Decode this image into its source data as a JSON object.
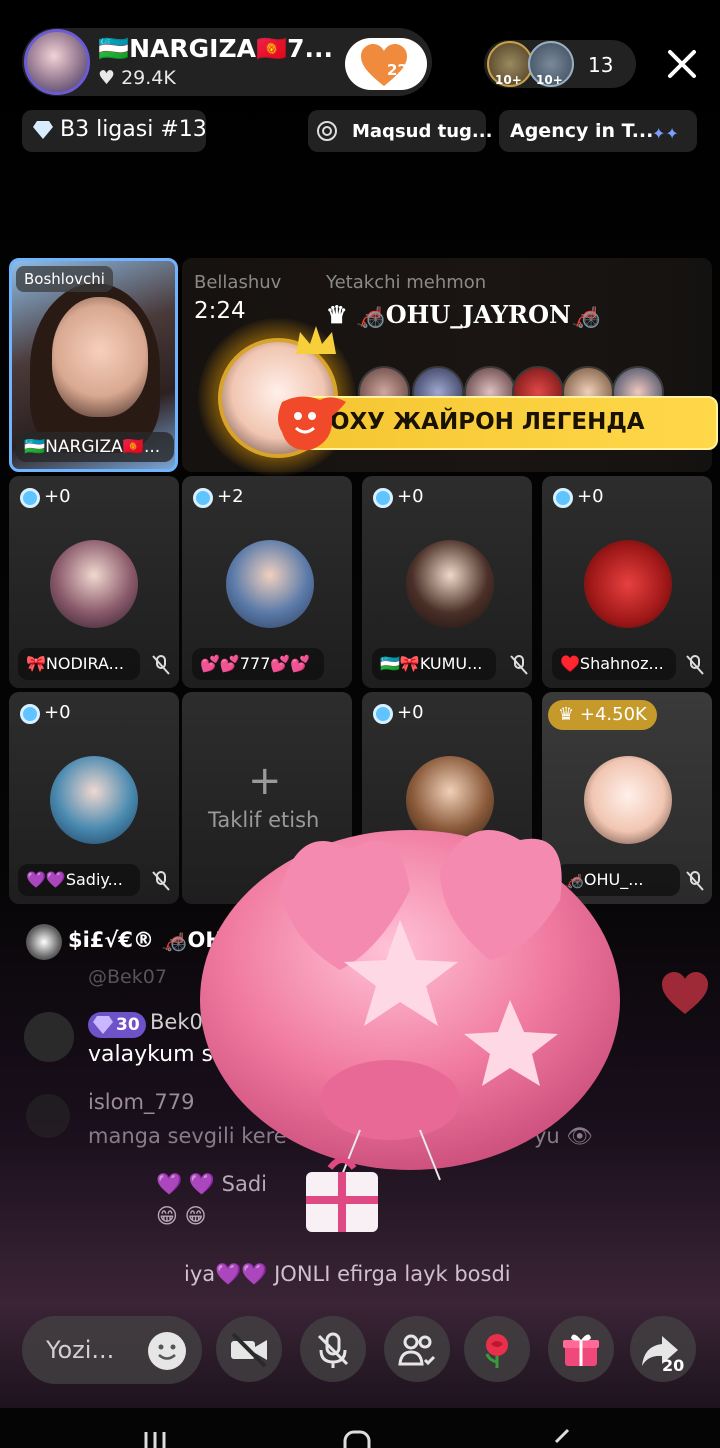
{
  "header": {
    "host_name": "🇺🇿NARGIZA🇰🇬7...",
    "host_likes": "♥ 29.4K",
    "heart_count": "22",
    "viewer_badges": [
      "10+",
      "10+"
    ],
    "viewer_count": "13"
  },
  "tags": {
    "league": "B3 ligasi #13",
    "goal": "Maqsud tug...",
    "agency": "Agency in T..."
  },
  "host_tile": {
    "role": "Boshlovchi",
    "name": "🇺🇿NARGIZA🇰🇬..."
  },
  "battle": {
    "label": "Bellashuv",
    "timer": "2:24",
    "leader_label": "Yetakchi mehmon",
    "leader_name": "♛ 🦽OHU_JAYRON🦽",
    "banner": "ОХУ ЖАЙРОН ЛЕГЕНДА"
  },
  "slots": [
    {
      "points": "+0",
      "name": "🎀NODIRA..."
    },
    {
      "points": "+2",
      "name": "💕💕777💕💕"
    },
    {
      "points": "+0",
      "name": "🇺🇿🎀KUMU..."
    },
    {
      "points": "+0",
      "name": "♥️Shahnoz..."
    },
    {
      "points": "+0",
      "name": "💜💜Sadiy..."
    },
    {
      "invite_label": "Taklif etish"
    },
    {
      "points": "+0",
      "name": ""
    },
    {
      "points": "♛ +4.50K",
      "name": "🦽OHU_..."
    }
  ],
  "chat": {
    "join_line": "$i£√€® 🦽OHU_JAY...",
    "faded_user": "@Bek07",
    "user1": "Bek07",
    "user1_level": "30",
    "message1": "valaykum sal",
    "user2": "islom_779",
    "message2": "manga sevgili kere",
    "message2_tail": "yu 👁",
    "user3": "💜 💜 Sadi",
    "emojis": "😁 😁",
    "event": "iya💜💜 JONLI efirga layk bosdi"
  },
  "bottom": {
    "compose_placeholder": "Yozi...",
    "share_count": "20"
  },
  "colors": {
    "accent_yellow": "#f5c531",
    "pill_bg": "#282828",
    "points_dot": "#5fc4ff",
    "balloon_pink": "#f07aa0"
  }
}
